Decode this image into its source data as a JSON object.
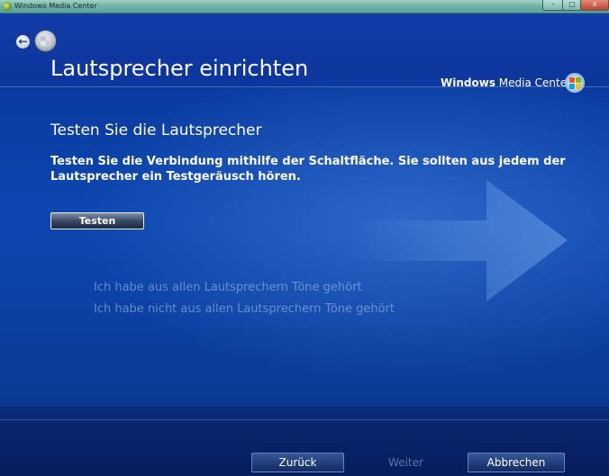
{
  "window": {
    "title": "Windows Media Center",
    "minimize": "–",
    "maximize": "□",
    "close": "x"
  },
  "header": {
    "title": "Lautsprecher einrichten",
    "brand_bold": "Windows",
    "brand_rest": " Media Center",
    "back_glyph": "←"
  },
  "main": {
    "heading": "Testen Sie die Lautsprecher",
    "instructions": "Testen Sie die Verbindung mithilfe der Schaltfläche. Sie sollten aus jedem der Lautsprecher ein Testgeräusch hören.",
    "test_button": "Testen",
    "options": [
      "Ich habe aus allen Lautsprechern Töne gehört",
      "Ich habe nicht aus allen Lautsprechern Töne gehört"
    ]
  },
  "footer": {
    "back": "Zurück",
    "next": "Weiter",
    "cancel": "Abbrechen"
  },
  "icons": {
    "back": "back-arrow-icon",
    "start": "windows-start-orb-icon",
    "logo": "media-center-logo-icon"
  },
  "colors": {
    "background": "#0b3aa0",
    "text": "#ffffff",
    "disabled_text": "#a0bee9"
  }
}
